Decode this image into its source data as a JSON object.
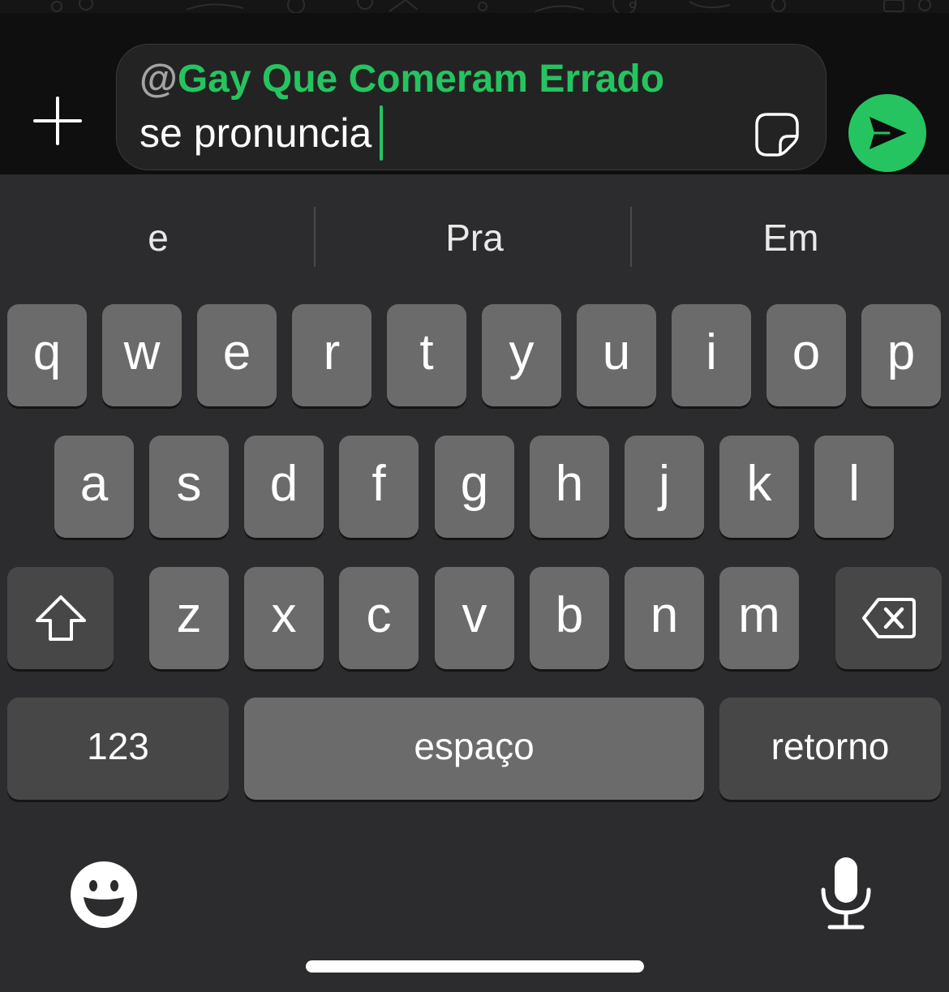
{
  "composer": {
    "mention_at": "@",
    "mention_name": "Gay Que Comeram Errado",
    "message_text": "se pronuncia",
    "accent_color": "#25c460",
    "attach_icon": "plus-icon",
    "sticker_icon": "sticker-icon",
    "send_icon": "send-icon"
  },
  "suggestions": [
    "e",
    "Pra",
    "Em"
  ],
  "keyboard": {
    "row1": [
      "q",
      "w",
      "e",
      "r",
      "t",
      "y",
      "u",
      "i",
      "o",
      "p"
    ],
    "row2": [
      "a",
      "s",
      "d",
      "f",
      "g",
      "h",
      "j",
      "k",
      "l"
    ],
    "row3": [
      "z",
      "x",
      "c",
      "v",
      "b",
      "n",
      "m"
    ],
    "shift_icon": "shift-icon",
    "backspace_icon": "backspace-icon",
    "numbers_label": "123",
    "space_label": "espaço",
    "return_label": "retorno",
    "emoji_icon": "emoji-icon",
    "mic_icon": "microphone-icon"
  }
}
